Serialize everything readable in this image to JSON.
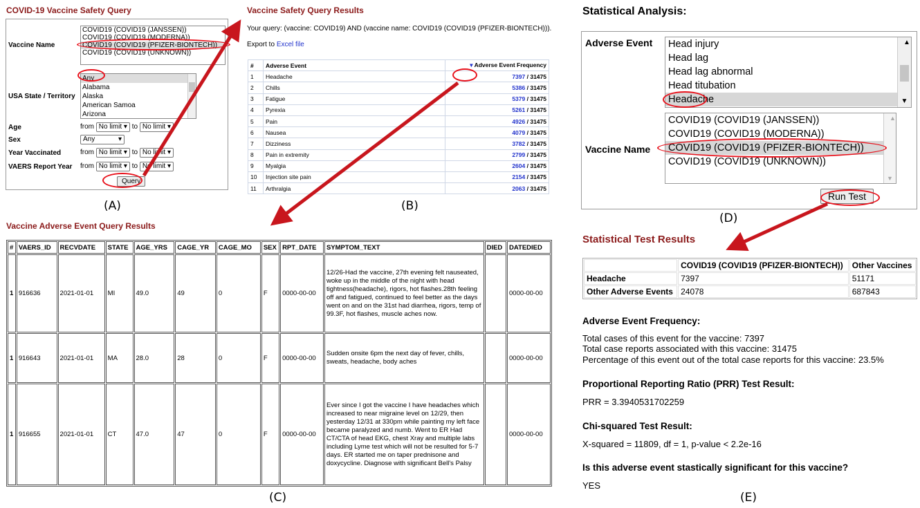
{
  "panel_a": {
    "title": "COVID-19 Vaccine Safety Query",
    "vaccine_label": "Vaccine Name",
    "vaccine_options": [
      "COVID19 (COVID19 (JANSSEN))",
      "COVID19 (COVID19 (MODERNA))",
      "COVID19 (COVID19 (PFIZER-BIONTECH))",
      "COVID19 (COVID19 (UNKNOWN))"
    ],
    "state_label": "USA State / Territory",
    "state_options": [
      "Any",
      "Alabama",
      "Alaska",
      "American Samoa",
      "Arizona"
    ],
    "age_label": "Age",
    "sex_label": "Sex",
    "year_vacc_label": "Year Vaccinated",
    "report_year_label": "VAERS Report Year",
    "from": "from",
    "to": "to",
    "no_limit": "No limit",
    "sex_value": "Any",
    "query_button": "Query",
    "caption": "(A)"
  },
  "panel_b": {
    "title": "Vaccine Safety Query Results",
    "query_text": "Your query: (vaccine: COVID19) AND (vaccine name: COVID19 (COVID19 (PFIZER-BIONTECH))).",
    "export_prefix": "Export to",
    "export_link": "Excel file",
    "col_num": "#",
    "col_event": "Adverse Event",
    "col_freq": "Adverse Event Frequency",
    "total": "/ 31475",
    "rows": [
      {
        "n": "1",
        "event": "Headache",
        "freq": "7397"
      },
      {
        "n": "2",
        "event": "Chills",
        "freq": "5386"
      },
      {
        "n": "3",
        "event": "Fatigue",
        "freq": "5379"
      },
      {
        "n": "4",
        "event": "Pyrexia",
        "freq": "5261"
      },
      {
        "n": "5",
        "event": "Pain",
        "freq": "4926"
      },
      {
        "n": "6",
        "event": "Nausea",
        "freq": "4079"
      },
      {
        "n": "7",
        "event": "Dizziness",
        "freq": "3782"
      },
      {
        "n": "8",
        "event": "Pain in extremity",
        "freq": "2799"
      },
      {
        "n": "9",
        "event": "Myalgia",
        "freq": "2604"
      },
      {
        "n": "10",
        "event": "Injection site pain",
        "freq": "2154"
      },
      {
        "n": "11",
        "event": "Arthralgia",
        "freq": "2063"
      }
    ],
    "caption": "(B)"
  },
  "panel_c": {
    "title": "Vaccine Adverse Event Query Results",
    "headers": [
      "#",
      "VAERS_ID",
      "RECVDATE",
      "STATE",
      "AGE_YRS",
      "CAGE_YR",
      "CAGE_MO",
      "SEX",
      "RPT_DATE",
      "SYMPTOM_TEXT",
      "DIED",
      "DATEDIED"
    ],
    "rows": [
      {
        "num": "1",
        "id": "916636",
        "recv": "2021-01-01",
        "state": "MI",
        "age": "49.0",
        "cage_yr": "49",
        "cage_mo": "0",
        "sex": "F",
        "rpt": "0000-00-00",
        "symptom": "12/26-Had the vaccine, 27th evening felt nauseated, woke up in the middle of the night with head tightness(headache), rigors, hot flashes.28th feeling off and fatigued, continued to feel better as the days went on and on the 31st had diarrhea, rigors, temp of 99.3F, hot flashes, muscle aches now.",
        "died": "",
        "datedied": "0000-00-00"
      },
      {
        "num": "1",
        "id": "916643",
        "recv": "2021-01-01",
        "state": "MA",
        "age": "28.0",
        "cage_yr": "28",
        "cage_mo": "0",
        "sex": "F",
        "rpt": "0000-00-00",
        "symptom": "Sudden onsite 6pm the next day of fever, chills, sweats, headache, body aches",
        "died": "",
        "datedied": "0000-00-00"
      },
      {
        "num": "1",
        "id": "916655",
        "recv": "2021-01-01",
        "state": "CT",
        "age": "47.0",
        "cage_yr": "47",
        "cage_mo": "0",
        "sex": "F",
        "rpt": "0000-00-00",
        "symptom": "Ever since I got the vaccine I have headaches which increased to near migraine level on 12/29, then yesterday 12/31 at 330pm while painting my left face became paralyzed and numb. Went to ER Had CT/CTA of head EKG, chest Xray and multiple labs including Lyme test which will not be resulted for 5-7 days. ER started me on taper prednisone and doxycycline. Diagnose with significant Bell's Palsy",
        "died": "",
        "datedied": "0000-00-00"
      }
    ],
    "caption": "(C)"
  },
  "panel_d": {
    "title": "Statistical Analysis:",
    "adverse_label": "Adverse Event",
    "adverse_options": [
      "Head injury",
      "Head lag",
      "Head lag abnormal",
      "Head titubation",
      "Headache"
    ],
    "vaccine_label": "Vaccine Name",
    "vaccine_options": [
      "COVID19 (COVID19 (JANSSEN))",
      "COVID19 (COVID19 (MODERNA))",
      "COVID19 (COVID19 (PFIZER-BIONTECH))",
      "COVID19 (COVID19 (UNKNOWN))"
    ],
    "run_button": "Run Test",
    "caption": "(D)"
  },
  "panel_e": {
    "title": "Statistical Test Results",
    "col_vaccine": "COVID19 (COVID19 (PFIZER-BIONTECH))",
    "col_other": "Other Vaccines",
    "row1_label": "Headache",
    "row1_v1": "7397",
    "row1_v2": "51171",
    "row2_label": "Other Adverse Events",
    "row2_v1": "24078",
    "row2_v2": "687843",
    "freq_heading": "Adverse Event Frequency:",
    "freq_line1": "Total cases of this event for the vaccine: 7397",
    "freq_line2": "Total case reports associated with this vaccine: 31475",
    "freq_line3": "Percentage of this event out of the total case reports for this vaccine: 23.5%",
    "prr_heading": "Proportional Reporting Ratio (PRR) Test Result:",
    "prr_value": "PRR = 3.3940531702259",
    "chi_heading": "Chi-squared Test Result:",
    "chi_value": "X-squared = 11809, df = 1, p-value < 2.2e-16",
    "sig_heading": "Is this adverse event stastically significant for this vaccine?",
    "sig_value": "YES",
    "caption": "(E)"
  },
  "colors": {
    "accent_red": "#e8111b",
    "title_red": "#8b1a1a",
    "link_blue": "#2233cc"
  }
}
